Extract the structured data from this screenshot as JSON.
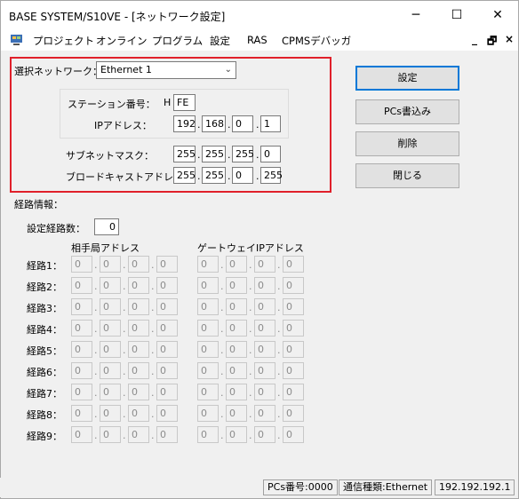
{
  "window": {
    "title": "BASE SYSTEM/S10VE - [ネットワーク設定]",
    "minimize": "─",
    "maximize": "☐",
    "close": "✕"
  },
  "menu": {
    "items": [
      "プロジェクト",
      "オンライン",
      "プログラム",
      "設定",
      "RAS",
      "CPMSデバッガ"
    ],
    "mdi_minimize": "_",
    "mdi_restore": "🗗",
    "mdi_close": "×"
  },
  "network": {
    "label": "選択ネットワーク：",
    "selected": "Ethernet 1",
    "station_label": "ステーション番号：",
    "station_prefix": "H",
    "station_value": "FE",
    "ip_label": "IPアドレス：",
    "ip": [
      "192",
      "168",
      "0",
      "1"
    ],
    "subnet_label": "サブネットマスク：",
    "subnet": [
      "255",
      "255",
      "255",
      "0"
    ],
    "broadcast_label": "ブロードキャストアドレス：",
    "broadcast": [
      "255",
      "255",
      "0",
      "255"
    ]
  },
  "buttons": {
    "settings": "設定",
    "pcs_write": "PCs書込み",
    "delete": "削除",
    "close": "閉じる"
  },
  "route": {
    "section_label": "経路情報：",
    "count_label": "設定経路数：",
    "count_value": "0",
    "dest_header": "相手局アドレス",
    "gateway_header": "ゲートウェイIPアドレス",
    "rows": [
      {
        "label": "経路1：",
        "dest": [
          "0",
          "0",
          "0",
          "0"
        ],
        "gw": [
          "0",
          "0",
          "0",
          "0"
        ]
      },
      {
        "label": "経路2：",
        "dest": [
          "0",
          "0",
          "0",
          "0"
        ],
        "gw": [
          "0",
          "0",
          "0",
          "0"
        ]
      },
      {
        "label": "経路3：",
        "dest": [
          "0",
          "0",
          "0",
          "0"
        ],
        "gw": [
          "0",
          "0",
          "0",
          "0"
        ]
      },
      {
        "label": "経路4：",
        "dest": [
          "0",
          "0",
          "0",
          "0"
        ],
        "gw": [
          "0",
          "0",
          "0",
          "0"
        ]
      },
      {
        "label": "経路5：",
        "dest": [
          "0",
          "0",
          "0",
          "0"
        ],
        "gw": [
          "0",
          "0",
          "0",
          "0"
        ]
      },
      {
        "label": "経路6：",
        "dest": [
          "0",
          "0",
          "0",
          "0"
        ],
        "gw": [
          "0",
          "0",
          "0",
          "0"
        ]
      },
      {
        "label": "経路7：",
        "dest": [
          "0",
          "0",
          "0",
          "0"
        ],
        "gw": [
          "0",
          "0",
          "0",
          "0"
        ]
      },
      {
        "label": "経路8：",
        "dest": [
          "0",
          "0",
          "0",
          "0"
        ],
        "gw": [
          "0",
          "0",
          "0",
          "0"
        ]
      },
      {
        "label": "経路9：",
        "dest": [
          "0",
          "0",
          "0",
          "0"
        ],
        "gw": [
          "0",
          "0",
          "0",
          "0"
        ]
      }
    ]
  },
  "status": {
    "pcs_number": "PCs番号:0000",
    "comm_type": "通信種類:Ethernet",
    "ip": "192.192.192.1"
  },
  "colors": {
    "highlight_frame": "#e0202a",
    "default_button_border": "#0078d7"
  }
}
